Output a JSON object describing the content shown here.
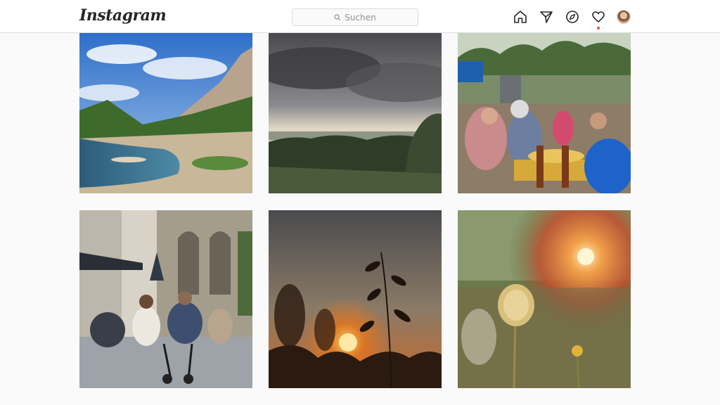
{
  "header": {
    "logo": "Instagram",
    "search_placeholder": "Suchen",
    "nav_icons": [
      "home-icon",
      "direct-message-icon",
      "explore-compass-icon",
      "activity-heart-icon",
      "profile-avatar"
    ]
  },
  "notifications": {
    "likes": "1",
    "follows": "1",
    "accent_color": "#ed4956"
  },
  "posts": [
    {
      "id": "post-river-gorge",
      "subject": "river-gorge-landscape"
    },
    {
      "id": "post-stormy-sky",
      "subject": "stormy-sky-over-forest"
    },
    {
      "id": "post-market",
      "subject": "street-market-stall"
    },
    {
      "id": "post-cafe-street",
      "subject": "old-town-street-cafe"
    },
    {
      "id": "post-sunset-grass",
      "subject": "sunset-through-grass"
    },
    {
      "id": "post-thistle-sun",
      "subject": "dry-flower-in-sunlight"
    }
  ]
}
